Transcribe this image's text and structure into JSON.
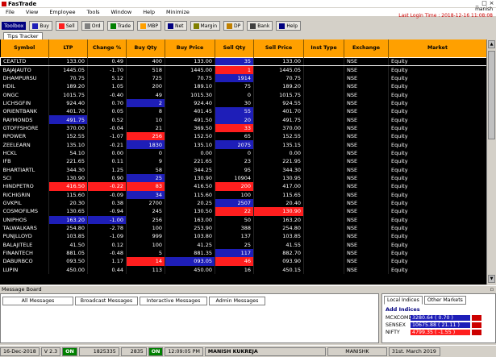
{
  "window": {
    "title": "FasTrade",
    "min": "_",
    "max": "□",
    "close": "×"
  },
  "menu": [
    "File",
    "View",
    "Employee",
    "Tools",
    "Window",
    "Help",
    "Minimize"
  ],
  "user": {
    "name": "manish",
    "last_login": "Last Login Time : 2018-12-16 11:08:08"
  },
  "toolbar": {
    "label": "Toolbox",
    "buttons": [
      {
        "label": "Buy",
        "color": "#1e1eb8"
      },
      {
        "label": "Sell",
        "color": "#ff1e1e"
      },
      {
        "label": "Ord",
        "color": "#808080"
      },
      {
        "label": "Trade",
        "color": "#008000"
      },
      {
        "label": "MBP",
        "color": "#ffa000"
      },
      {
        "label": "Net",
        "color": "#000080"
      },
      {
        "label": "Margin",
        "color": "#808000"
      },
      {
        "label": "DP",
        "color": "#c08000"
      },
      {
        "label": "Bank",
        "color": "#404040"
      },
      {
        "label": "Help",
        "color": "#000080"
      }
    ]
  },
  "tabs": {
    "tips_tracker": "Tips Tracker"
  },
  "market_watch": {
    "columns": [
      "Symbol",
      "LTP",
      "Change %",
      "Buy Qty",
      "Buy Price",
      "Sell Qty",
      "Sell Price",
      "Inst Type",
      "Exchange",
      "Market"
    ],
    "rows": [
      {
        "symbol": "CEATLTD",
        "ltp": "133.00",
        "chg": "0.49",
        "bq": "400",
        "bp": "133.00",
        "sq": "35",
        "sp": "133.00",
        "inst": "",
        "exch": "NSE",
        "mkt": "Equity",
        "bq_c": "",
        "sq_c": "blue",
        "sp_c": "",
        "chg_c": "",
        "ltp_c": "",
        "bp_c": "",
        "sel": true
      },
      {
        "symbol": "BAJAJAUTO",
        "ltp": "1445.05",
        "chg": "-1.70",
        "bq": "518",
        "bp": "1445.00",
        "sq": "1",
        "sp": "1445.05",
        "inst": "",
        "exch": "NSE",
        "mkt": "Equity",
        "bq_c": "",
        "sq_c": "red",
        "sp_c": "",
        "chg_c": "",
        "ltp_c": "",
        "bp_c": ""
      },
      {
        "symbol": "DHAMPURSU",
        "ltp": "70.75",
        "chg": "5.12",
        "bq": "725",
        "bp": "70.75",
        "sq": "1914",
        "sp": "70.75",
        "inst": "",
        "exch": "NSE",
        "mkt": "Equity",
        "bq_c": "",
        "sq_c": "blue",
        "sp_c": "",
        "chg_c": "",
        "ltp_c": "",
        "bp_c": ""
      },
      {
        "symbol": "HDIL",
        "ltp": "189.20",
        "chg": "1.05",
        "bq": "200",
        "bp": "189.10",
        "sq": "75",
        "sp": "189.20",
        "inst": "",
        "exch": "NSE",
        "mkt": "Equity",
        "bq_c": "",
        "sq_c": "",
        "sp_c": "",
        "chg_c": "",
        "ltp_c": "",
        "bp_c": ""
      },
      {
        "symbol": "ONGC",
        "ltp": "1015.75",
        "chg": "-0.40",
        "bq": "49",
        "bp": "1015.30",
        "sq": "0",
        "sp": "1015.75",
        "inst": "",
        "exch": "NSE",
        "mkt": "Equity",
        "bq_c": "",
        "sq_c": "",
        "sp_c": "",
        "chg_c": "",
        "ltp_c": "",
        "bp_c": ""
      },
      {
        "symbol": "LICHSGFIN",
        "ltp": "924.40",
        "chg": "0.70",
        "bq": "2",
        "bp": "924.40",
        "sq": "30",
        "sp": "924.55",
        "inst": "",
        "exch": "NSE",
        "mkt": "Equity",
        "bq_c": "blue",
        "sq_c": "",
        "sp_c": "",
        "chg_c": "",
        "ltp_c": "",
        "bp_c": ""
      },
      {
        "symbol": "ORIENTBANK",
        "ltp": "401.70",
        "chg": "0.05",
        "bq": "8",
        "bp": "401.45",
        "sq": "55",
        "sp": "401.70",
        "inst": "",
        "exch": "NSE",
        "mkt": "Equity",
        "bq_c": "",
        "sq_c": "blue",
        "sp_c": "",
        "chg_c": "",
        "ltp_c": "",
        "bp_c": ""
      },
      {
        "symbol": "RAYMONDS",
        "ltp": "491.75",
        "chg": "0.52",
        "bq": "10",
        "bp": "491.50",
        "sq": "20",
        "sp": "491.75",
        "inst": "",
        "exch": "NSE",
        "mkt": "Equity",
        "bq_c": "",
        "sq_c": "blue",
        "sp_c": "",
        "chg_c": "",
        "ltp_c": "blue",
        "bp_c": ""
      },
      {
        "symbol": "GTOFFSHORE",
        "ltp": "370.00",
        "chg": "-0.04",
        "bq": "21",
        "bp": "369.50",
        "sq": "33",
        "sp": "370.00",
        "inst": "",
        "exch": "NSE",
        "mkt": "Equity",
        "bq_c": "",
        "sq_c": "red",
        "sp_c": "",
        "chg_c": "",
        "ltp_c": "",
        "bp_c": ""
      },
      {
        "symbol": "RPOWER",
        "ltp": "152.55",
        "chg": "-1.07",
        "bq": "256",
        "bp": "152.50",
        "sq": "65",
        "sp": "152.55",
        "inst": "",
        "exch": "NSE",
        "mkt": "Equity",
        "bq_c": "red",
        "sq_c": "",
        "sp_c": "",
        "chg_c": "",
        "ltp_c": "",
        "bp_c": ""
      },
      {
        "symbol": "ZEELEARN",
        "ltp": "135.10",
        "chg": "-0.21",
        "bq": "1830",
        "bp": "135.10",
        "sq": "2075",
        "sp": "135.15",
        "inst": "",
        "exch": "NSE",
        "mkt": "Equity",
        "bq_c": "blue",
        "sq_c": "blue",
        "sp_c": "",
        "chg_c": "",
        "ltp_c": "",
        "bp_c": ""
      },
      {
        "symbol": "HCKL",
        "ltp": "54.10",
        "chg": "0.00",
        "bq": "0",
        "bp": "0.00",
        "sq": "0",
        "sp": "0.00",
        "inst": "",
        "exch": "NSE",
        "mkt": "Equity",
        "bq_c": "",
        "sq_c": "",
        "sp_c": "",
        "chg_c": "",
        "ltp_c": "",
        "bp_c": ""
      },
      {
        "symbol": "IFB",
        "ltp": "221.65",
        "chg": "0.11",
        "bq": "9",
        "bp": "221.65",
        "sq": "23",
        "sp": "221.95",
        "inst": "",
        "exch": "NSE",
        "mkt": "Equity",
        "bq_c": "",
        "sq_c": "",
        "sp_c": "",
        "chg_c": "",
        "ltp_c": "",
        "bp_c": ""
      },
      {
        "symbol": "BHARTIARTL",
        "ltp": "344.30",
        "chg": "1.25",
        "bq": "58",
        "bp": "344.25",
        "sq": "95",
        "sp": "344.30",
        "inst": "",
        "exch": "NSE",
        "mkt": "Equity",
        "bq_c": "",
        "sq_c": "",
        "sp_c": "",
        "chg_c": "",
        "ltp_c": "",
        "bp_c": ""
      },
      {
        "symbol": "SCI",
        "ltp": "130.90",
        "chg": "0.90",
        "bq": "25",
        "bp": "130.90",
        "sq": "10904",
        "sp": "130.95",
        "inst": "",
        "exch": "NSE",
        "mkt": "Equity",
        "bq_c": "blue",
        "sq_c": "",
        "sp_c": "",
        "chg_c": "",
        "ltp_c": "",
        "bp_c": ""
      },
      {
        "symbol": "HINDPETRO",
        "ltp": "416.50",
        "chg": "-0.22",
        "bq": "83",
        "bp": "416.50",
        "sq": "200",
        "sp": "417.00",
        "inst": "",
        "exch": "NSE",
        "mkt": "Equity",
        "bq_c": "red",
        "sq_c": "red",
        "sp_c": "",
        "chg_c": "red",
        "ltp_c": "red",
        "bp_c": ""
      },
      {
        "symbol": "RICHIGRIN",
        "ltp": "115.60",
        "chg": "-0.09",
        "bq": "34",
        "bp": "115.60",
        "sq": "100",
        "sp": "115.65",
        "inst": "",
        "exch": "NSE",
        "mkt": "Equity",
        "bq_c": "blue",
        "sq_c": "",
        "sp_c": "",
        "chg_c": "",
        "ltp_c": "",
        "bp_c": ""
      },
      {
        "symbol": "GVKPIL",
        "ltp": "20.30",
        "chg": "0.38",
        "bq": "2700",
        "bp": "20.25",
        "sq": "2507",
        "sp": "20.40",
        "inst": "",
        "exch": "NSE",
        "mkt": "Equity",
        "bq_c": "",
        "sq_c": "blue",
        "sp_c": "",
        "chg_c": "",
        "ltp_c": "",
        "bp_c": ""
      },
      {
        "symbol": "COSMOFILMS",
        "ltp": "130.65",
        "chg": "-0.94",
        "bq": "245",
        "bp": "130.50",
        "sq": "22",
        "sp": "130.90",
        "inst": "",
        "exch": "NSE",
        "mkt": "Equity",
        "bq_c": "",
        "sq_c": "red",
        "sp_c": "red",
        "chg_c": "",
        "ltp_c": "",
        "bp_c": ""
      },
      {
        "symbol": "UNIPHOS",
        "ltp": "163.20",
        "chg": "-1.00",
        "bq": "256",
        "bp": "163.00",
        "sq": "50",
        "sp": "163.20",
        "inst": "",
        "exch": "NSE",
        "mkt": "Equity",
        "bq_c": "",
        "sq_c": "",
        "sp_c": "",
        "chg_c": "blue",
        "ltp_c": "blue",
        "bp_c": ""
      },
      {
        "symbol": "TALWALKARS",
        "ltp": "254.80",
        "chg": "-2.78",
        "bq": "100",
        "bp": "253.90",
        "sq": "388",
        "sp": "254.80",
        "inst": "",
        "exch": "NSE",
        "mkt": "Equity",
        "bq_c": "",
        "sq_c": "",
        "sp_c": "",
        "chg_c": "",
        "ltp_c": "",
        "bp_c": ""
      },
      {
        "symbol": "PUNJLLOYD",
        "ltp": "103.85",
        "chg": "-1.09",
        "bq": "999",
        "bp": "103.80",
        "sq": "137",
        "sp": "103.85",
        "inst": "",
        "exch": "NSE",
        "mkt": "Equity",
        "bq_c": "",
        "sq_c": "",
        "sp_c": "",
        "chg_c": "",
        "ltp_c": "",
        "bp_c": ""
      },
      {
        "symbol": "BALAJITELE",
        "ltp": "41.50",
        "chg": "0.12",
        "bq": "100",
        "bp": "41.25",
        "sq": "25",
        "sp": "41.55",
        "inst": "",
        "exch": "NSE",
        "mkt": "Equity",
        "bq_c": "",
        "sq_c": "",
        "sp_c": "",
        "chg_c": "",
        "ltp_c": "",
        "bp_c": ""
      },
      {
        "symbol": "FINANTECH",
        "ltp": "881.05",
        "chg": "-0.48",
        "bq": "5",
        "bp": "881.35",
        "sq": "117",
        "sp": "882.70",
        "inst": "",
        "exch": "NSE",
        "mkt": "Equity",
        "bq_c": "",
        "sq_c": "blue",
        "sp_c": "",
        "chg_c": "",
        "ltp_c": "",
        "bp_c": ""
      },
      {
        "symbol": "DABURBCO",
        "ltp": "093.50",
        "chg": "1.17",
        "bq": "14",
        "bp": "093.05",
        "sq": "46",
        "sp": "093.90",
        "inst": "",
        "exch": "NSE",
        "mkt": "Equity",
        "bq_c": "red",
        "sq_c": "red",
        "sp_c": "",
        "chg_c": "",
        "ltp_c": "",
        "bp_c": "blue"
      },
      {
        "symbol": "LUPIN",
        "ltp": "450.00",
        "chg": "0.44",
        "bq": "113",
        "bp": "450.00",
        "sq": "16",
        "sp": "450.15",
        "inst": "",
        "exch": "NSE",
        "mkt": "Equity",
        "bq_c": "",
        "sq_c": "",
        "sp_c": "",
        "chg_c": "",
        "ltp_c": "",
        "bp_c": ""
      }
    ]
  },
  "message_board": {
    "title": "Message Board",
    "pin": "▫",
    "tabs": [
      "All Messages",
      "Broadcast Messages",
      "Interactive Messages",
      "Admin Messages"
    ]
  },
  "indices": {
    "tabs": [
      "Local Indices",
      "Other Markets"
    ],
    "add_label": "Add Indices",
    "rows": [
      {
        "name": "MCXCOMDEX",
        "value": "3280.64 ( 0.70 )",
        "color": "blue"
      },
      {
        "name": "SENSEX",
        "value": "10675.88 ( 21.11 )",
        "color": "blue"
      },
      {
        "name": "NIFTY",
        "value": "4799.35 ( -1.55 )",
        "color": "red"
      }
    ]
  },
  "status": {
    "date": "16-Dec-2018",
    "version": "V 2.3",
    "on1": "ON",
    "n1": "1825335",
    "n2": "2835",
    "on2": "ON",
    "time": "12:09:05 PM",
    "operator": "MANISH KUKREJA",
    "user": "MANISHK",
    "expiry": "31st. March 2019"
  }
}
